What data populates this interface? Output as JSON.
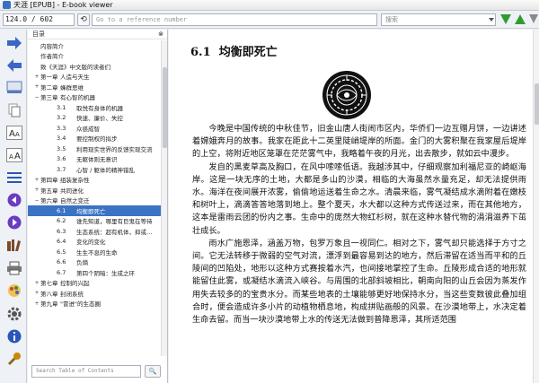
{
  "window": {
    "title": "天涯 [EPUB] - E-book viewer"
  },
  "toolbar": {
    "position_value": "124.0 / 602",
    "back_label": "⟲",
    "reference_placeholder": "Go to a reference number",
    "search_placeholder": "搜索"
  },
  "toc": {
    "header_label": "目录",
    "header_icon": "⊗",
    "items": [
      {
        "toggle": "",
        "num": "",
        "label": "内容简介",
        "selected": false
      },
      {
        "toggle": "",
        "num": "",
        "label": "作者简介",
        "selected": false
      },
      {
        "toggle": "",
        "num": "",
        "label": "致《天涯》中文版的读者们",
        "selected": false
      },
      {
        "toggle": "+",
        "num": "第一章",
        "label": "人造与天生",
        "selected": false
      },
      {
        "toggle": "+",
        "num": "第二章",
        "label": "蜂群思维",
        "selected": false
      },
      {
        "toggle": "−",
        "num": "第三章",
        "label": "有心智的机器",
        "selected": false
      },
      {
        "toggle": "",
        "num": "3.1",
        "label": "取悦有身体的机器",
        "selected": false
      },
      {
        "toggle": "",
        "num": "3.2",
        "label": "快速、廉价、失控",
        "selected": false
      },
      {
        "toggle": "",
        "num": "3.3",
        "label": "众惑成智",
        "selected": false
      },
      {
        "toggle": "",
        "num": "3.4",
        "label": "要控制权的拟步",
        "selected": false
      },
      {
        "toggle": "",
        "num": "3.5",
        "label": "利用现实世界的反馈实现交流",
        "selected": false
      },
      {
        "toggle": "",
        "num": "3.6",
        "label": "无躯体则无意识",
        "selected": false
      },
      {
        "toggle": "",
        "num": "3.7",
        "label": "心智 / 躯体的精神错乱",
        "selected": false
      },
      {
        "toggle": "+",
        "num": "第四章",
        "label": "组装复杂性",
        "selected": false
      },
      {
        "toggle": "+",
        "num": "第五章",
        "label": "共同进化",
        "selected": false
      },
      {
        "toggle": "−",
        "num": "第六章",
        "label": "自然之变迁",
        "selected": false
      },
      {
        "toggle": "",
        "num": "6.1",
        "label": "均衡即死亡",
        "selected": true
      },
      {
        "toggle": "",
        "num": "6.2",
        "label": "谁先知道，哪里有巨鬼在等待",
        "selected": false
      },
      {
        "toggle": "",
        "num": "6.3",
        "label": "生态系统：超有机体，抑或…",
        "selected": false
      },
      {
        "toggle": "",
        "num": "6.4",
        "label": "变化的变化",
        "selected": false
      },
      {
        "toggle": "",
        "num": "6.5",
        "label": "生生不息的生命",
        "selected": false
      },
      {
        "toggle": "",
        "num": "6.6",
        "label": "负熵",
        "selected": false
      },
      {
        "toggle": "",
        "num": "6.7",
        "label": "第四个阴暗：生成之环",
        "selected": false
      },
      {
        "toggle": "+",
        "num": "第七章",
        "label": "控制的兴起",
        "selected": false
      },
      {
        "toggle": "+",
        "num": "第八章",
        "label": "封闭系统",
        "selected": false
      },
      {
        "toggle": "+",
        "num": "第九章",
        "label": "\"冒进\"的生态圈",
        "selected": false
      }
    ],
    "search_placeholder": "Search Table of Contents",
    "search_button": "🔍"
  },
  "lefttools": [
    {
      "name": "forward-arrow-icon",
      "color": "#3a66c8"
    },
    {
      "name": "back-arrow-icon",
      "color": "#3a66c8"
    },
    {
      "name": "library-icon",
      "color": "#5a7ab8"
    },
    {
      "name": "copy-icon",
      "color": "#888888"
    },
    {
      "name": "font-larger-icon",
      "color": "#222222"
    },
    {
      "name": "font-smaller-icon",
      "color": "#222222"
    },
    {
      "name": "toc-icon",
      "color": "#2a56b8"
    },
    {
      "name": "previous-page-icon",
      "color": "#6a3cc0"
    },
    {
      "name": "next-page-icon",
      "color": "#6a3cc0"
    },
    {
      "name": "reference-mode-icon",
      "color": "#7a4a2a"
    },
    {
      "name": "print-icon",
      "color": "#444444"
    },
    {
      "name": "theme-icon",
      "color": "#cc4444"
    },
    {
      "name": "settings-gear-icon",
      "color": "#555555"
    },
    {
      "name": "info-icon",
      "color": "#2a56b8"
    },
    {
      "name": "wrench-icon",
      "color": "#cc8800"
    }
  ],
  "content": {
    "chapter_number": "6.1",
    "chapter_title": "均衡即死亡",
    "paragraphs": [
      "今晚是中国传统的中秋佳节，旧金山唐人街闹市区内，华侨们一边互赠月饼，一边讲述着嫦娥奔月的故事。我家在距此十二英里陡峭堤岸的所面。金门的大雾积聚在我家屋后堤岸的上空，将附近地区笼罩在茫茫雾气中，我略着午夜的月光，出去散步，就如云中漫步。",
      "发自的黑麦草高及胸口，在风中嗦嗦低语。我越涉其中，仔细观察加利福尼亚的崎岖海岸。这是一块无序的土地，大都是多山的沙漠，相临的大海虽然水量充足，却无法提供雨水。海洋在夜间展开浓雾，偷偷地运送着生命之水。清晨来临，雾气凝结成水滴附着在嫩枝和树叶上，滴滴答答地落到地上。整个夏天，水大都以这种方式传送过来，而在其他地方，这本是雷雨云团的份内之事。生命中的庞然大物红杉树，就在这种水替代物的涓涓滋养下茁壮成长。",
      "雨水广施恩泽，涵盖万物，包罗万象且一视同仁。相对之下，雾气却只能选择于方寸之间。它无法转移于微弱的空气对流，漂浮到最容易到达的地方，然后滞留在适当而平和的丘陵间的凹陷处，地形以这种方式赛按着水汽，也间接地掌控了生命。丘陵形成合适的地形就能留住此雾，或凝结水滴流入峡谷。与周围的北部斜坡相比，朝南向阳的山丘会因为蒸发作用失去较多的的宝贵水分。而某些地表的土壤能够更好地保持水分，当这些变数彼此叠加组合时，便会造成许多小片的动植物栖息地，构成拼贴画般的风景。在沙漠地带上，水决定着生命去留。而当一块沙漠地带上水的传送无法做到普降恩泽，其所适范围"
    ]
  }
}
